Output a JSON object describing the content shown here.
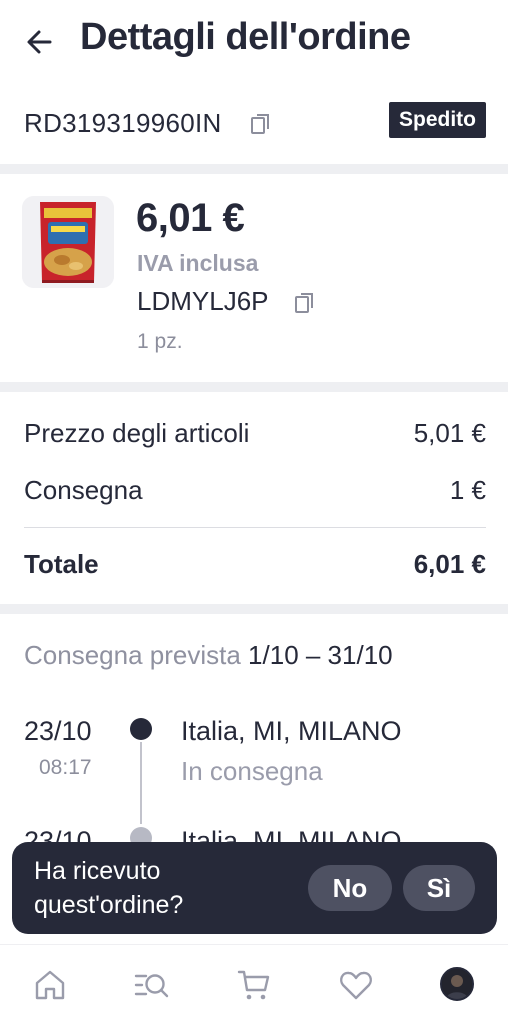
{
  "header": {
    "title": "Dettagli dell'ordine"
  },
  "order": {
    "tracking_number": "RD319319960IN",
    "status": "Spedito"
  },
  "product": {
    "price": "6,01 €",
    "vat_note": "IVA inclusa",
    "sku": "LDMYLJ6P",
    "quantity": "1 pz."
  },
  "summary": {
    "rows": [
      {
        "label": "Prezzo degli articoli",
        "value": "5,01 €"
      },
      {
        "label": "Consegna",
        "value": "1 €"
      },
      {
        "label": "Totale",
        "value": "6,01 €"
      }
    ]
  },
  "delivery": {
    "label": "Consegna prevista",
    "range": "1/10 – 31/10"
  },
  "timeline": [
    {
      "date": "23/10",
      "time": "08:17",
      "place": "Italia, MI, MILANO",
      "status": "In consegna"
    },
    {
      "date": "23/10",
      "place": "Italia, MI, MILANO"
    }
  ],
  "prompt": {
    "question": "Ha ricevuto quest'ordine?",
    "no_label": "No",
    "yes_label": "Sì"
  },
  "bottom_nav": [
    "home-icon",
    "catalog-search-icon",
    "cart-icon",
    "heart-icon",
    "profile-avatar"
  ],
  "colors": {
    "primary": "#262939",
    "muted": "#9a9cab",
    "divider": "#eeeff2"
  }
}
